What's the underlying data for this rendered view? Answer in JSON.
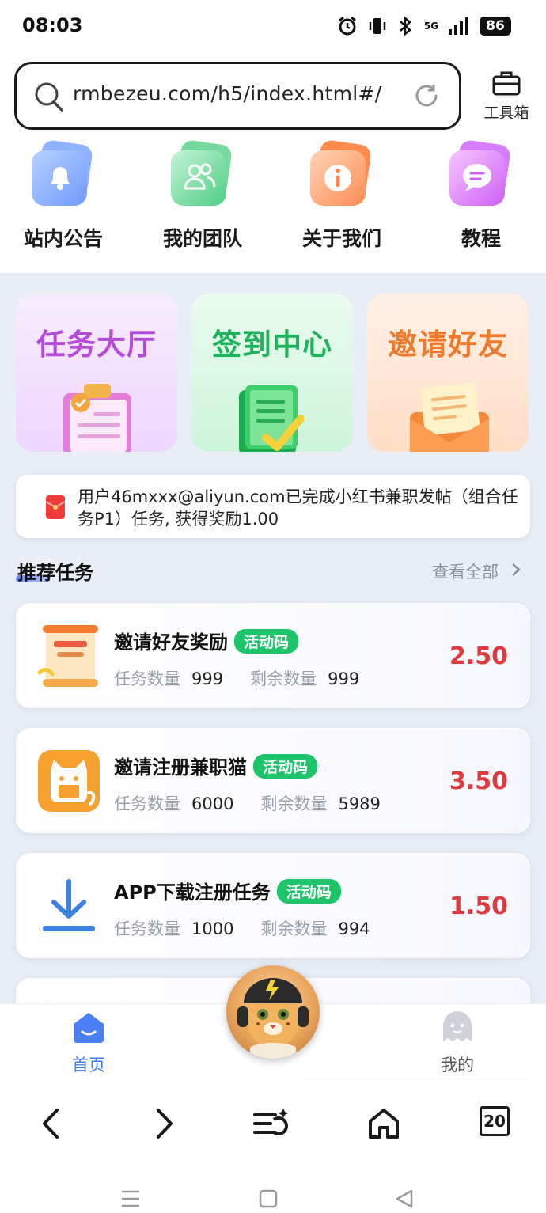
{
  "status_bar": {
    "time": "08:03",
    "network": "5G",
    "battery": "86",
    "icons": [
      "alarm-icon",
      "vibrate-icon",
      "bluetooth-icon",
      "signal-icon",
      "battery-icon"
    ]
  },
  "url_bar": {
    "url": "rmbezeu.com/h5/index.html#/",
    "toolbox_label": "工具箱"
  },
  "quick_nav": [
    {
      "label": "站内公告",
      "icon": "bell-icon",
      "color": "#5b8cff"
    },
    {
      "label": "我的团队",
      "icon": "team-icon",
      "color": "#37c77b"
    },
    {
      "label": "关于我们",
      "icon": "info-icon",
      "color": "#ff7a3d"
    },
    {
      "label": "教程",
      "icon": "chat-icon",
      "color": "#c85bff"
    }
  ],
  "feature_cards": [
    {
      "title": "任务大厅",
      "icon": "clipboard-icon",
      "title_color": "#b34ad9"
    },
    {
      "title": "签到中心",
      "icon": "checklist-icon",
      "title_color": "#1eb25a"
    },
    {
      "title": "邀请好友",
      "icon": "envelope-icon",
      "title_color": "#f07a2c"
    }
  ],
  "notice": {
    "icon": "red-envelope-icon",
    "text": "用户46mxxx@aliyun.com已完成小红书兼职发帖（组合任务P1）任务, 获得奖励1.00"
  },
  "recommended": {
    "title": "推荐任务",
    "more_label": "查看全部",
    "count_label": "任务数量",
    "remain_label": "剩余数量",
    "tasks": [
      {
        "name": "邀请好友奖励",
        "badge": "活动码",
        "count": "999",
        "remaining": "999",
        "price": "2.50",
        "icon": "invite-scroll-icon"
      },
      {
        "name": "邀请注册兼职猫",
        "badge": "活动码",
        "count": "6000",
        "remaining": "5989",
        "price": "3.50",
        "icon": "cat-app-icon"
      },
      {
        "name": "APP下载注册任务",
        "badge": "活动码",
        "count": "1000",
        "remaining": "994",
        "price": "1.50",
        "icon": "download-icon"
      }
    ]
  },
  "tab_bar": {
    "home_label": "首页",
    "mine_label": "我的",
    "active_color": "#3f7bf0"
  },
  "browser_nav": {
    "tab_count": "20",
    "buttons": [
      "back-icon",
      "forward-icon",
      "menu-icon",
      "home-icon",
      "tabs-icon"
    ]
  }
}
